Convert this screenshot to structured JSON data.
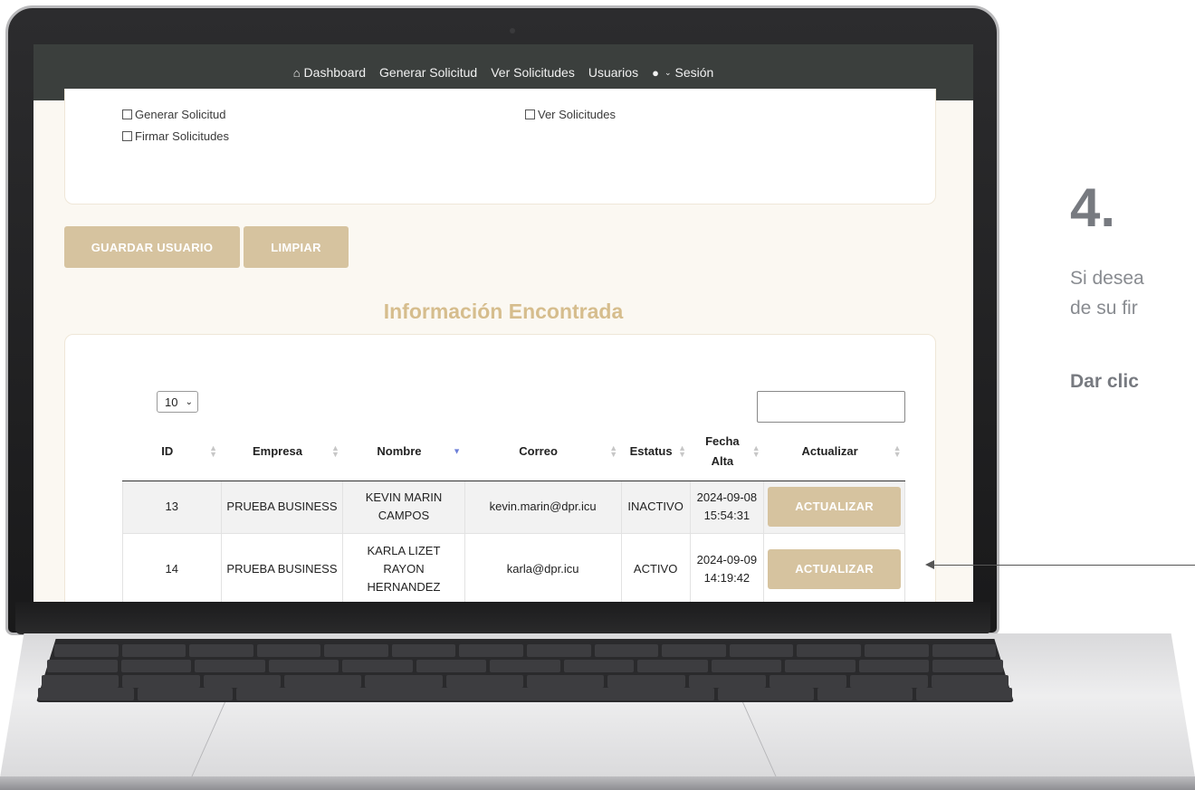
{
  "navbar": {
    "items": [
      {
        "label": "Dashboard",
        "icon": "home-icon"
      },
      {
        "label": "Generar Solicitud"
      },
      {
        "label": "Ver Solicitudes"
      },
      {
        "label": "Usuarios"
      },
      {
        "label": "Sesión",
        "icon": "user-icon"
      }
    ]
  },
  "permissions": {
    "items": [
      "Generar Solicitud",
      "Firmar Solicitudes",
      "Ver Solicitudes"
    ]
  },
  "actions": {
    "save_label": "GUARDAR USUARIO",
    "clear_label": "LIMPIAR"
  },
  "results": {
    "title": "Información Encontrada",
    "page_length": "10",
    "search_value": "",
    "columns": [
      "ID",
      "Empresa",
      "Nombre",
      "Correo",
      "Estatus",
      "Fecha Alta",
      "Actualizar"
    ],
    "rows": [
      {
        "id": "13",
        "empresa": "PRUEBA BUSINESS",
        "nombre": "KEVIN MARIN CAMPOS",
        "correo": "kevin.marin@dpr.icu",
        "estatus": "INACTIVO",
        "fecha": "2024-09-08 15:54:31",
        "action": "ACTUALIZAR"
      },
      {
        "id": "14",
        "empresa": "PRUEBA BUSINESS",
        "nombre": "KARLA LIZET RAYON HERNANDEZ",
        "correo": "karla@dpr.icu",
        "estatus": "ACTIVO",
        "fecha": "2024-09-09 14:19:42",
        "action": "ACTUALIZAR"
      }
    ]
  },
  "step": {
    "number": "4.",
    "description_line1": "Si desea",
    "description_line2": "de su fir",
    "cta": "Dar clic"
  },
  "colors": {
    "accent_gold": "#d6c39f",
    "title_gold": "#d6bd8d",
    "navbar_bg": "#3b3f3d"
  }
}
